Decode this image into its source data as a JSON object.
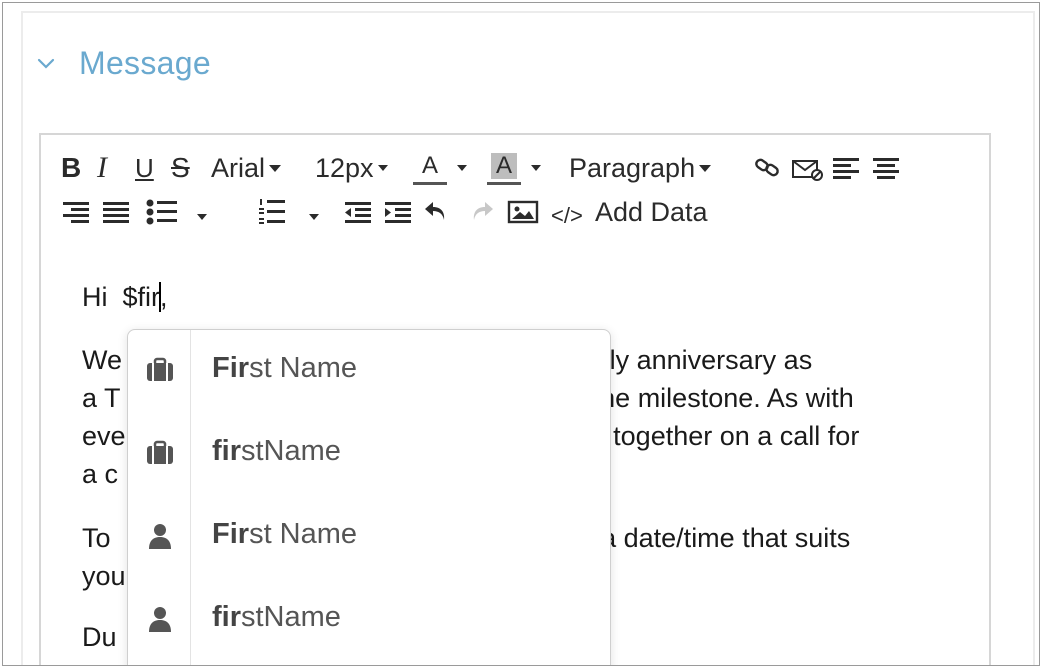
{
  "section": {
    "title": "Message",
    "chevron_icon": "chevron-down-icon"
  },
  "toolbar": {
    "bold_label": "B",
    "italic_label": "I",
    "underline_label": "U",
    "strike_label": "S",
    "font_family": "Arial",
    "font_size": "12px",
    "text_color_label": "A",
    "bg_color_label": "A",
    "paragraph_label": "Paragraph",
    "add_data_label": "Add Data",
    "html_label": "</>"
  },
  "content": {
    "greeting_prefix": "Hi  $fir",
    "greeting_suffix": ",",
    "para1": [
      "We                                                          yearly anniversary as",
      "a T                                                         out the milestone. As with",
      "eve                                                        o get together on a call for",
      "a c                                                         ion."
    ],
    "para2": [
      "To                                                          pick a date/time that suits",
      "you"
    ],
    "para3": "Du"
  },
  "autocomplete": {
    "items": [
      {
        "match": "Fir",
        "rest": "st Name",
        "icon": "briefcase-icon"
      },
      {
        "match": "fir",
        "rest": "stName",
        "icon": "briefcase-icon"
      },
      {
        "match": "Fir",
        "rest": "st Name",
        "icon": "user-icon"
      },
      {
        "match": "fir",
        "rest": "stName",
        "icon": "user-icon"
      }
    ]
  },
  "colors": {
    "accent": "#6aa9cf",
    "text_color_underline": "#555555",
    "bg_color_swatch": "#bdbdbd"
  }
}
